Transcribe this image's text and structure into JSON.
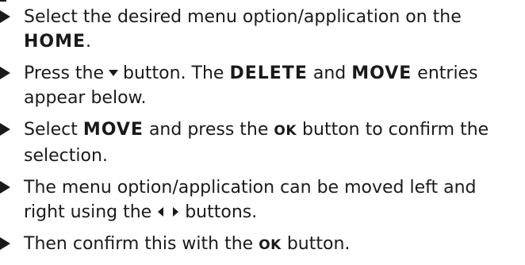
{
  "steps": [
    {
      "line1": "Select the desired menu option/application on the",
      "line2_keyword": "HOME",
      "line2_after": "."
    },
    {
      "before": "Press the",
      "icon": "down-arrow-icon",
      "mid": "button. The",
      "keyword1": "DELETE",
      "connector": "and",
      "keyword2": "MOVE",
      "after": "entries",
      "line2": "appear below."
    },
    {
      "before": "Select",
      "keyword1": "MOVE",
      "mid": "and press the",
      "keyword2": "OK",
      "after": "button to confirm the",
      "line2": "selection."
    },
    {
      "line1": "The menu option/application can be moved left and",
      "line2_before": "right using the",
      "icons": [
        "left-arrow-icon",
        "right-arrow-icon"
      ],
      "line2_after": "buttons."
    },
    {
      "before": "Then confirm this with the",
      "keyword": "OK",
      "after": "button."
    }
  ]
}
